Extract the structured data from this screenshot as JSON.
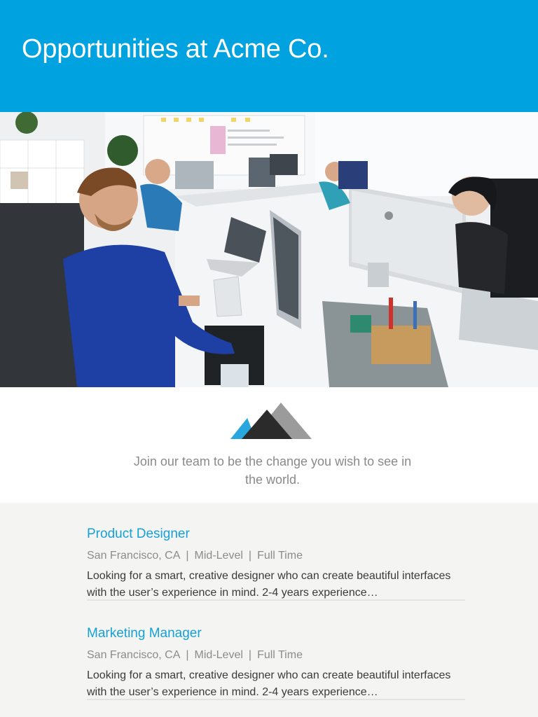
{
  "header": {
    "title": "Opportunities at Acme Co."
  },
  "hero": {
    "image": "office-team-photo"
  },
  "intro": {
    "logo": "mountains-logo",
    "tagline": "Join our team to be the change you wish to see in the world."
  },
  "jobs": [
    {
      "title": "Product Designer",
      "location": "San Francisco, CA",
      "level": "Mid-Level",
      "type": "Full Time",
      "separator": "|",
      "description": "Looking for a smart, creative designer who can create beautiful interfaces with the user’s experience in mind. 2-4 years experience…"
    },
    {
      "title": "Marketing Manager",
      "location": "San Francisco, CA",
      "level": "Mid-Level",
      "type": "Full Time",
      "separator": "|",
      "description": "Looking for a smart, creative designer who can create beautiful interfaces with the user’s experience in mind. 2-4 years experience…"
    }
  ],
  "colors": {
    "brand": "#00a3e0",
    "link": "#16a1d6",
    "background": "#f4f4f2"
  }
}
